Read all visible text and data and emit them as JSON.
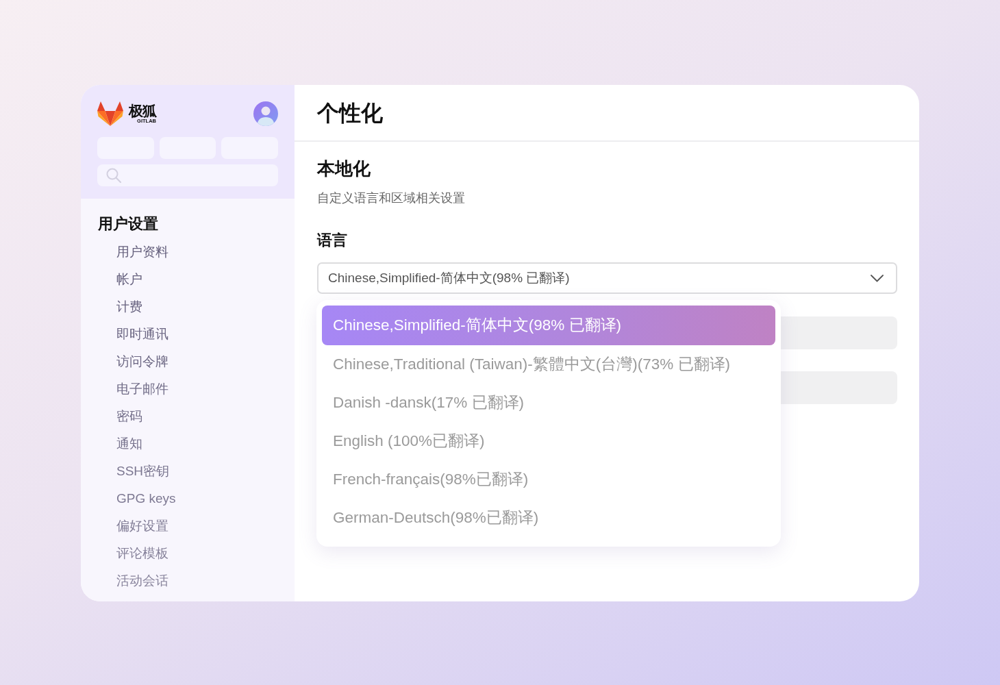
{
  "logo": {
    "name": "极狐",
    "subtitle": "GITLAB"
  },
  "sidebar": {
    "heading": "用户设置",
    "items": [
      {
        "label": "用户资料"
      },
      {
        "label": "帐户"
      },
      {
        "label": "计费"
      },
      {
        "label": "即时通讯"
      },
      {
        "label": "访问令牌"
      },
      {
        "label": "电子邮件"
      },
      {
        "label": "密码"
      },
      {
        "label": "通知"
      },
      {
        "label": "SSH密钥"
      },
      {
        "label": "GPG keys"
      },
      {
        "label": "偏好设置"
      },
      {
        "label": "评论模板"
      },
      {
        "label": "活动会话"
      }
    ]
  },
  "page": {
    "title": "个性化"
  },
  "section": {
    "title": "本地化",
    "description": "自定义语言和区域相关设置"
  },
  "language": {
    "label": "语言",
    "value": "Chinese,Simplified-简体中文(98% 已翻译)",
    "expanded": true,
    "options": [
      {
        "label": "Chinese,Simplified-简体中文(98% 已翻译)",
        "selected": true
      },
      {
        "label": "Chinese,Traditional (Taiwan)-繁體中文(台灣)(73% 已翻译)",
        "selected": false
      },
      {
        "label": "Danish -dansk(17% 已翻译)",
        "selected": false
      },
      {
        "label": "English (100%已翻译)",
        "selected": false
      },
      {
        "label": "French-français(98%已翻译)",
        "selected": false
      },
      {
        "label": "German-Deutsch(98%已翻译)",
        "selected": false
      }
    ]
  }
}
